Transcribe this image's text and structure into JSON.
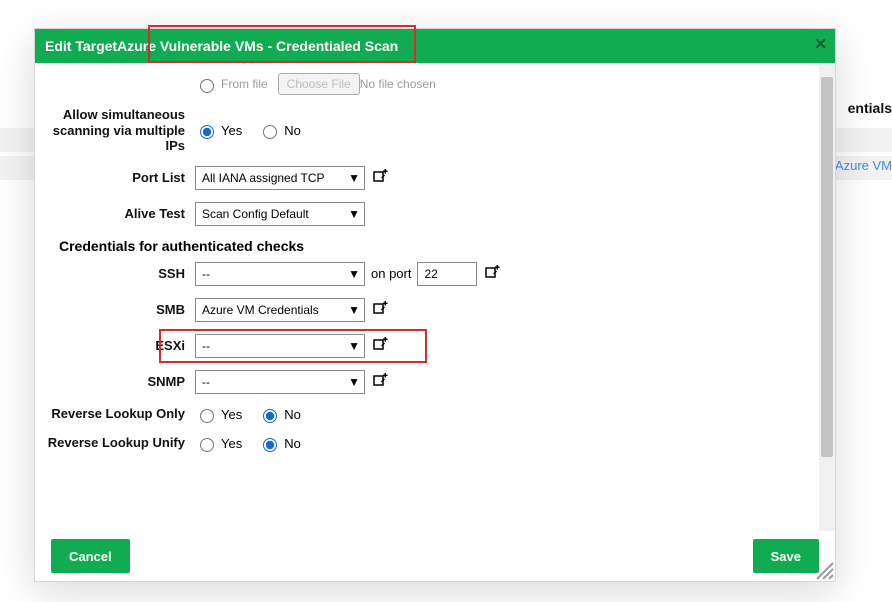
{
  "background": {
    "header_right_text": "entials",
    "link_text": "Azure VM"
  },
  "modal": {
    "title_prefix": "Edit Target ",
    "title_main": "Azure Vulnerable VMs - Credentialed Scan",
    "fromfile": {
      "radio_label": "From file",
      "button": "Choose File",
      "status": "No file chosen"
    },
    "allow_simul_label": "Allow simultaneous scanning via multiple IPs",
    "yes": "Yes",
    "no": "No",
    "allow_simul_value": "yes",
    "portlist_label": "Port List",
    "portlist_value": "All IANA assigned TCP",
    "alive_label": "Alive Test",
    "alive_value": "Scan Config Default",
    "cred_section": "Credentials for authenticated checks",
    "ssh_label": "SSH",
    "ssh_value": "--",
    "ssh_onport": "on port",
    "ssh_port": "22",
    "smb_label": "SMB",
    "smb_value": "Azure VM Credentials",
    "esxi_label": "ESXi",
    "esxi_value": "--",
    "snmp_label": "SNMP",
    "snmp_value": "--",
    "revonly_label": "Reverse Lookup Only",
    "revonly_value": "no",
    "revunify_label": "Reverse Lookup Unify",
    "revunify_value": "no",
    "cancel": "Cancel",
    "save": "Save"
  }
}
